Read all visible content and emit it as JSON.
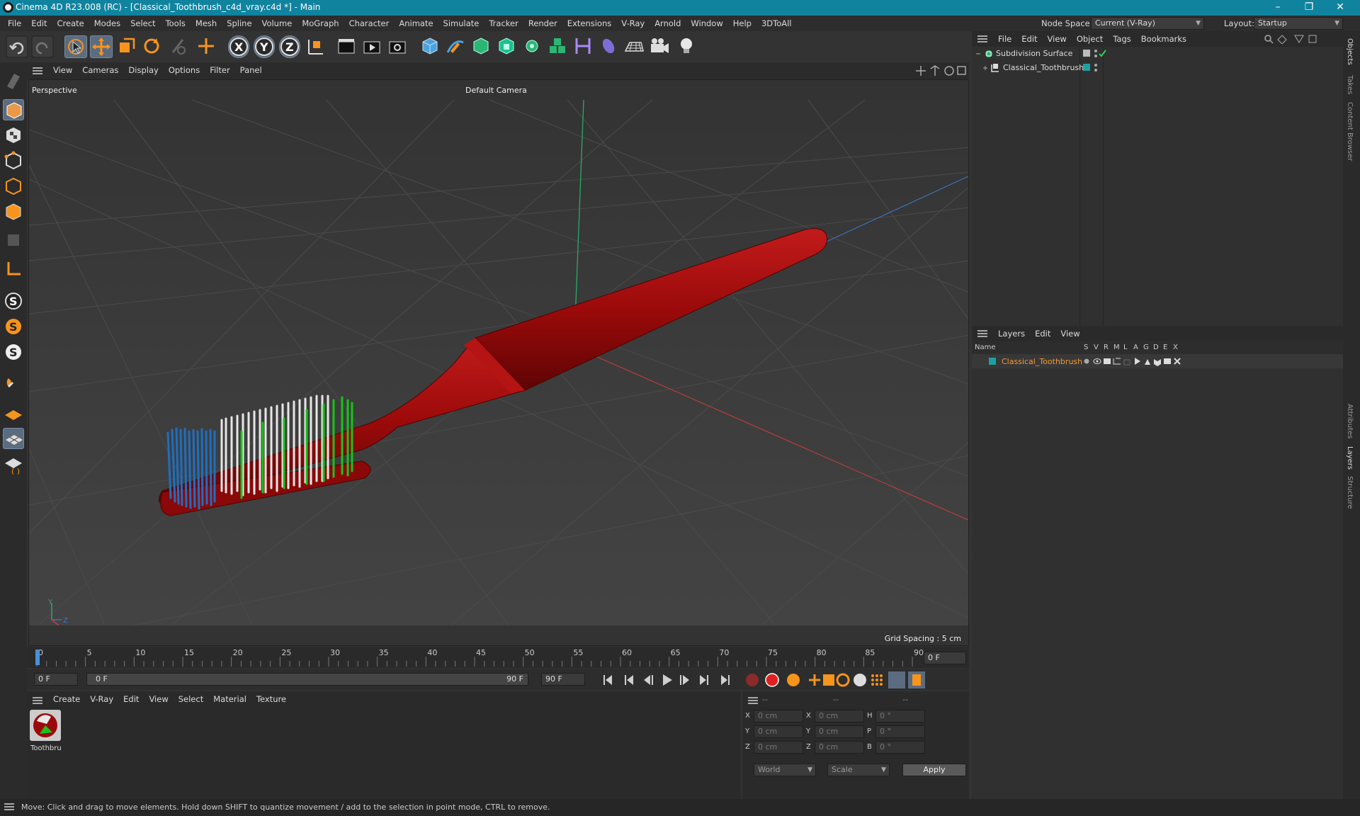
{
  "window": {
    "title": "Cinema 4D R23.008 (RC) - [Classical_Toothbrush_c4d_vray.c4d *] - Main",
    "minimize": "–",
    "maximize": "❐",
    "close": "✕"
  },
  "menubar": {
    "items": [
      "File",
      "Edit",
      "Create",
      "Modes",
      "Select",
      "Tools",
      "Mesh",
      "Spline",
      "Volume",
      "MoGraph",
      "Character",
      "Animate",
      "Simulate",
      "Tracker",
      "Render",
      "Extensions",
      "V-Ray",
      "Arnold",
      "Window",
      "Help",
      "3DToAll"
    ],
    "node_space_label": "Node Space:",
    "node_space_value": "Current (V-Ray)",
    "layout_label": "Layout:",
    "layout_value": "Startup"
  },
  "toolbar": {
    "axis_x": "X",
    "axis_y": "Y",
    "axis_z": "Z"
  },
  "viewport": {
    "menu": [
      "View",
      "Cameras",
      "Display",
      "Options",
      "Filter",
      "Panel"
    ],
    "name": "Perspective",
    "camera": "Default Camera",
    "grid_spacing": "Grid Spacing : 5 cm",
    "axis_y": "Y",
    "axis_z": "Z",
    "axis_x": "X"
  },
  "timeline": {
    "ticks": [
      "0",
      "5",
      "10",
      "15",
      "20",
      "25",
      "30",
      "35",
      "40",
      "45",
      "50",
      "55",
      "60",
      "65",
      "70",
      "75",
      "80",
      "85",
      "90"
    ],
    "current_frame": "0 F"
  },
  "transport": {
    "start": "0 F",
    "range_start": "0 F",
    "range_end": "90 F",
    "end": "90 F"
  },
  "material_panel": {
    "menu": [
      "Create",
      "V-Ray",
      "Edit",
      "View",
      "Select",
      "Material",
      "Texture"
    ],
    "material_name": "Toothbru"
  },
  "coord_panel": {
    "col_headers": [
      "--",
      "--",
      "--"
    ],
    "rows": [
      {
        "pos_label": "X",
        "pos": "0 cm",
        "size_label": "X",
        "size": "0 cm",
        "rot_label": "H",
        "rot": "0 °"
      },
      {
        "pos_label": "Y",
        "pos": "0 cm",
        "size_label": "Y",
        "size": "0 cm",
        "rot_label": "P",
        "rot": "0 °"
      },
      {
        "pos_label": "Z",
        "pos": "0 cm",
        "size_label": "Z",
        "size": "0 cm",
        "rot_label": "B",
        "rot": "0 °"
      }
    ],
    "coord_system": "World",
    "size_mode": "Scale",
    "apply": "Apply"
  },
  "objects_panel": {
    "menu": [
      "File",
      "Edit",
      "View",
      "Object",
      "Tags",
      "Bookmarks"
    ],
    "items": [
      {
        "name": "Subdivision Surface"
      },
      {
        "name": "Classical_Toothbrush"
      }
    ]
  },
  "layers_panel": {
    "menu": [
      "Layers",
      "Edit",
      "View"
    ],
    "name_header": "Name",
    "flag_headers": [
      "S",
      "V",
      "R",
      "M",
      "L",
      "A",
      "G",
      "D",
      "E",
      "X"
    ],
    "layer_name": "Classical_Toothbrush",
    "layer_color": "#1fa0a0"
  },
  "side_tabs": [
    "Objects",
    "Takes",
    "Content Browser",
    "Attributes",
    "Layers",
    "Structure"
  ],
  "status": "Move: Click and drag to move elements. Hold down SHIFT to quantize movement / add to the selection in point mode, CTRL to remove.",
  "colors": {
    "titlebar": "#10839e",
    "handle": "#9b0a0a",
    "bristle_blue": "#1e6fc0",
    "bristle_green": "#18c418",
    "bristle_white": "#e6e6e6",
    "accent_orange": "#f7941d",
    "layer_text": "#f39a33"
  }
}
